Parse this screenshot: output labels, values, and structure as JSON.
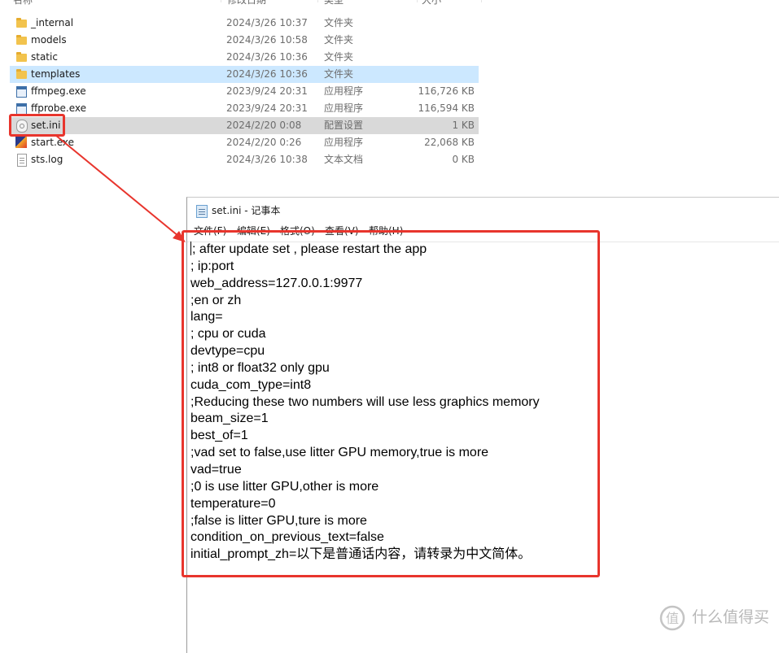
{
  "explorer": {
    "headers": {
      "name": "名称",
      "date": "修改日期",
      "type": "类型",
      "size": "大小"
    },
    "files": [
      {
        "name": "_internal",
        "date": "2024/3/26 10:37",
        "type": "文件夹",
        "size": "",
        "icon": "folder-icon"
      },
      {
        "name": "models",
        "date": "2024/3/26 10:58",
        "type": "文件夹",
        "size": "",
        "icon": "folder-icon"
      },
      {
        "name": "static",
        "date": "2024/3/26 10:36",
        "type": "文件夹",
        "size": "",
        "icon": "folder-icon"
      },
      {
        "name": "templates",
        "date": "2024/3/26 10:36",
        "type": "文件夹",
        "size": "",
        "icon": "folder-icon"
      },
      {
        "name": "ffmpeg.exe",
        "date": "2023/9/24 20:31",
        "type": "应用程序",
        "size": "116,726 KB",
        "icon": "exe-icon"
      },
      {
        "name": "ffprobe.exe",
        "date": "2023/9/24 20:31",
        "type": "应用程序",
        "size": "116,594 KB",
        "icon": "exe-icon"
      },
      {
        "name": "set.ini",
        "date": "2024/2/20 0:08",
        "type": "配置设置",
        "size": "1 KB",
        "icon": "settings-file-icon"
      },
      {
        "name": "start.exe",
        "date": "2024/2/20 0:26",
        "type": "应用程序",
        "size": "22,068 KB",
        "icon": "app-icon"
      },
      {
        "name": "sts.log",
        "date": "2024/3/26 10:38",
        "type": "文本文档",
        "size": "0 KB",
        "icon": "text-file-icon"
      }
    ]
  },
  "notepad": {
    "title": "set.ini - 记事本",
    "menu": [
      "文件(F)",
      "编辑(E)",
      "格式(O)",
      "查看(V)",
      "帮助(H)"
    ],
    "lines": [
      "; after update set , please restart the app",
      "; ip:port",
      "web_address=127.0.0.1:9977",
      ";en or zh",
      "lang=",
      "; cpu or cuda",
      "devtype=cpu",
      "; int8 or float32 only gpu",
      "cuda_com_type=int8",
      ";Reducing these two numbers will use less graphics memory",
      "beam_size=1",
      "best_of=1",
      ";vad set to false,use litter GPU memory,true is more",
      "vad=true",
      ";0 is use litter GPU,other is more",
      "temperature=0",
      ";false is litter GPU,ture is more",
      "condition_on_previous_text=false",
      "initial_prompt_zh=以下是普通话内容，请转录为中文简体。"
    ]
  },
  "watermark": {
    "text": "什么值得买"
  },
  "colors": {
    "annotation": "#e8352d",
    "selection_light": "#cce8ff",
    "selection_grey": "#d9d9d9"
  }
}
